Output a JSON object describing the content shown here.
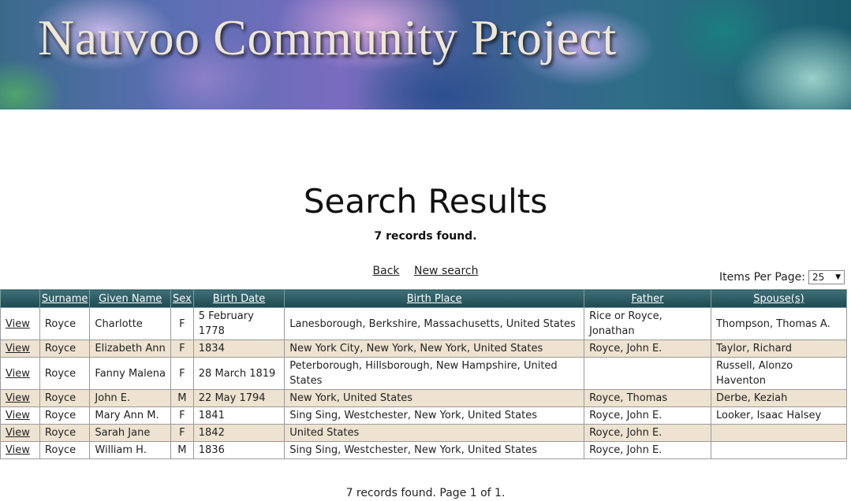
{
  "banner": {
    "title": "Nauvoo Community Project"
  },
  "page": {
    "title": "Search Results",
    "records_found": "7 records found.",
    "footer": "7 records found. Page 1 of 1."
  },
  "nav": {
    "back": "Back",
    "new_search": "New search"
  },
  "pagination": {
    "items_per_page_label": "Items Per Page:",
    "items_per_page_value": "25"
  },
  "table": {
    "columns": [
      "",
      "Surname",
      "Given Name",
      "Sex",
      "Birth Date",
      "Birth Place",
      "Father",
      "Spouse(s)"
    ],
    "rows": [
      {
        "view": "View",
        "surname": "Royce",
        "given": "Charlotte",
        "sex": "F",
        "birth_date": "5 February 1778",
        "birth_place": "Lanesborough, Berkshire, Massachusetts, United States",
        "father": "Rice or Royce, Jonathan",
        "spouse": "Thompson, Thomas A."
      },
      {
        "view": "View",
        "surname": "Royce",
        "given": "Elizabeth Ann",
        "sex": "F",
        "birth_date": "1834",
        "birth_place": "New York City, New York, New York, United States",
        "father": "Royce, John E.",
        "spouse": "Taylor, Richard"
      },
      {
        "view": "View",
        "surname": "Royce",
        "given": "Fanny Malena",
        "sex": "F",
        "birth_date": "28 March 1819",
        "birth_place": "Peterborough, Hillsborough, New Hampshire, United States",
        "father": "",
        "spouse": "Russell, Alonzo Haventon"
      },
      {
        "view": "View",
        "surname": "Royce",
        "given": "John E.",
        "sex": "M",
        "birth_date": "22 May 1794",
        "birth_place": "New York, United States",
        "father": "Royce, Thomas",
        "spouse": "Derbe, Keziah"
      },
      {
        "view": "View",
        "surname": "Royce",
        "given": "Mary Ann M.",
        "sex": "F",
        "birth_date": "1841",
        "birth_place": "Sing Sing, Westchester, New York, United States",
        "father": "Royce, John E.",
        "spouse": "Looker, Isaac Halsey"
      },
      {
        "view": "View",
        "surname": "Royce",
        "given": "Sarah Jane",
        "sex": "F",
        "birth_date": "1842",
        "birth_place": "United States",
        "father": "Royce, John E.",
        "spouse": ""
      },
      {
        "view": "View",
        "surname": "Royce",
        "given": "William H.",
        "sex": "M",
        "birth_date": "1836",
        "birth_place": "Sing Sing, Westchester, New York, United States",
        "father": "Royce, John E.",
        "spouse": ""
      }
    ]
  }
}
